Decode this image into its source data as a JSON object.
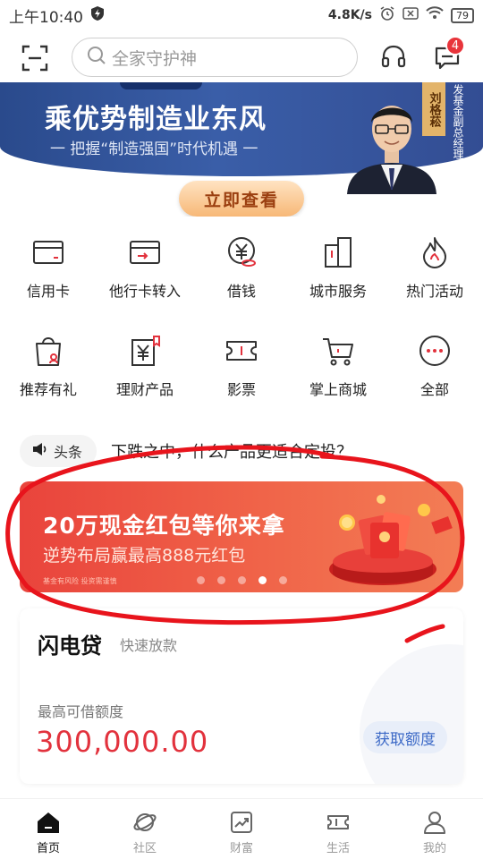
{
  "status_bar": {
    "time": "上午10:40",
    "speed": "4.8K/s",
    "battery": "79"
  },
  "search": {
    "placeholder": "全家守护神"
  },
  "message_badge": "4",
  "hero": {
    "title": "乘优势制造业东风",
    "subtitle": "一 把握“制造强国”时代机遇 一",
    "person_name": "刘格菘",
    "person_title": "发基金副总经理",
    "button": "立即查看"
  },
  "shortcuts_row1": [
    {
      "label": "信用卡",
      "icon": "credit-card-icon"
    },
    {
      "label": "他行卡转入",
      "icon": "card-transfer-icon"
    },
    {
      "label": "借钱",
      "icon": "yuan-coin-icon"
    },
    {
      "label": "城市服务",
      "icon": "city-building-icon"
    },
    {
      "label": "热门活动",
      "icon": "flame-icon"
    }
  ],
  "shortcuts_row2": [
    {
      "label": "推荐有礼",
      "icon": "gift-bag-icon"
    },
    {
      "label": "理财产品",
      "icon": "wealth-doc-icon"
    },
    {
      "label": "影票",
      "icon": "ticket-icon"
    },
    {
      "label": "掌上商城",
      "icon": "shopping-cart-icon"
    },
    {
      "label": "全部",
      "icon": "more-dots-icon"
    }
  ],
  "news": {
    "tag": "头条",
    "text": "下跌之中，什么产品更适合定投？"
  },
  "promo": {
    "title": "20万现金红包等你来拿",
    "subtitle": "逆势布局赢最高888元红包",
    "note": "基金有风险 投资需谨慎",
    "slide_count": 5,
    "active_slide": 4
  },
  "loan": {
    "title": "闪电贷",
    "subtitle": "快速放款",
    "label": "最高可借额度",
    "amount": "300,000.00",
    "button": "获取额度"
  },
  "bottom_nav": [
    {
      "label": "首页",
      "active": true
    },
    {
      "label": "社区",
      "active": false
    },
    {
      "label": "财富",
      "active": false
    },
    {
      "label": "生活",
      "active": false
    },
    {
      "label": "我的",
      "active": false
    }
  ],
  "colors": {
    "brand_red": "#e2323d",
    "hero_blue": "#2a4a8c",
    "annotation_red": "#e8141c"
  }
}
